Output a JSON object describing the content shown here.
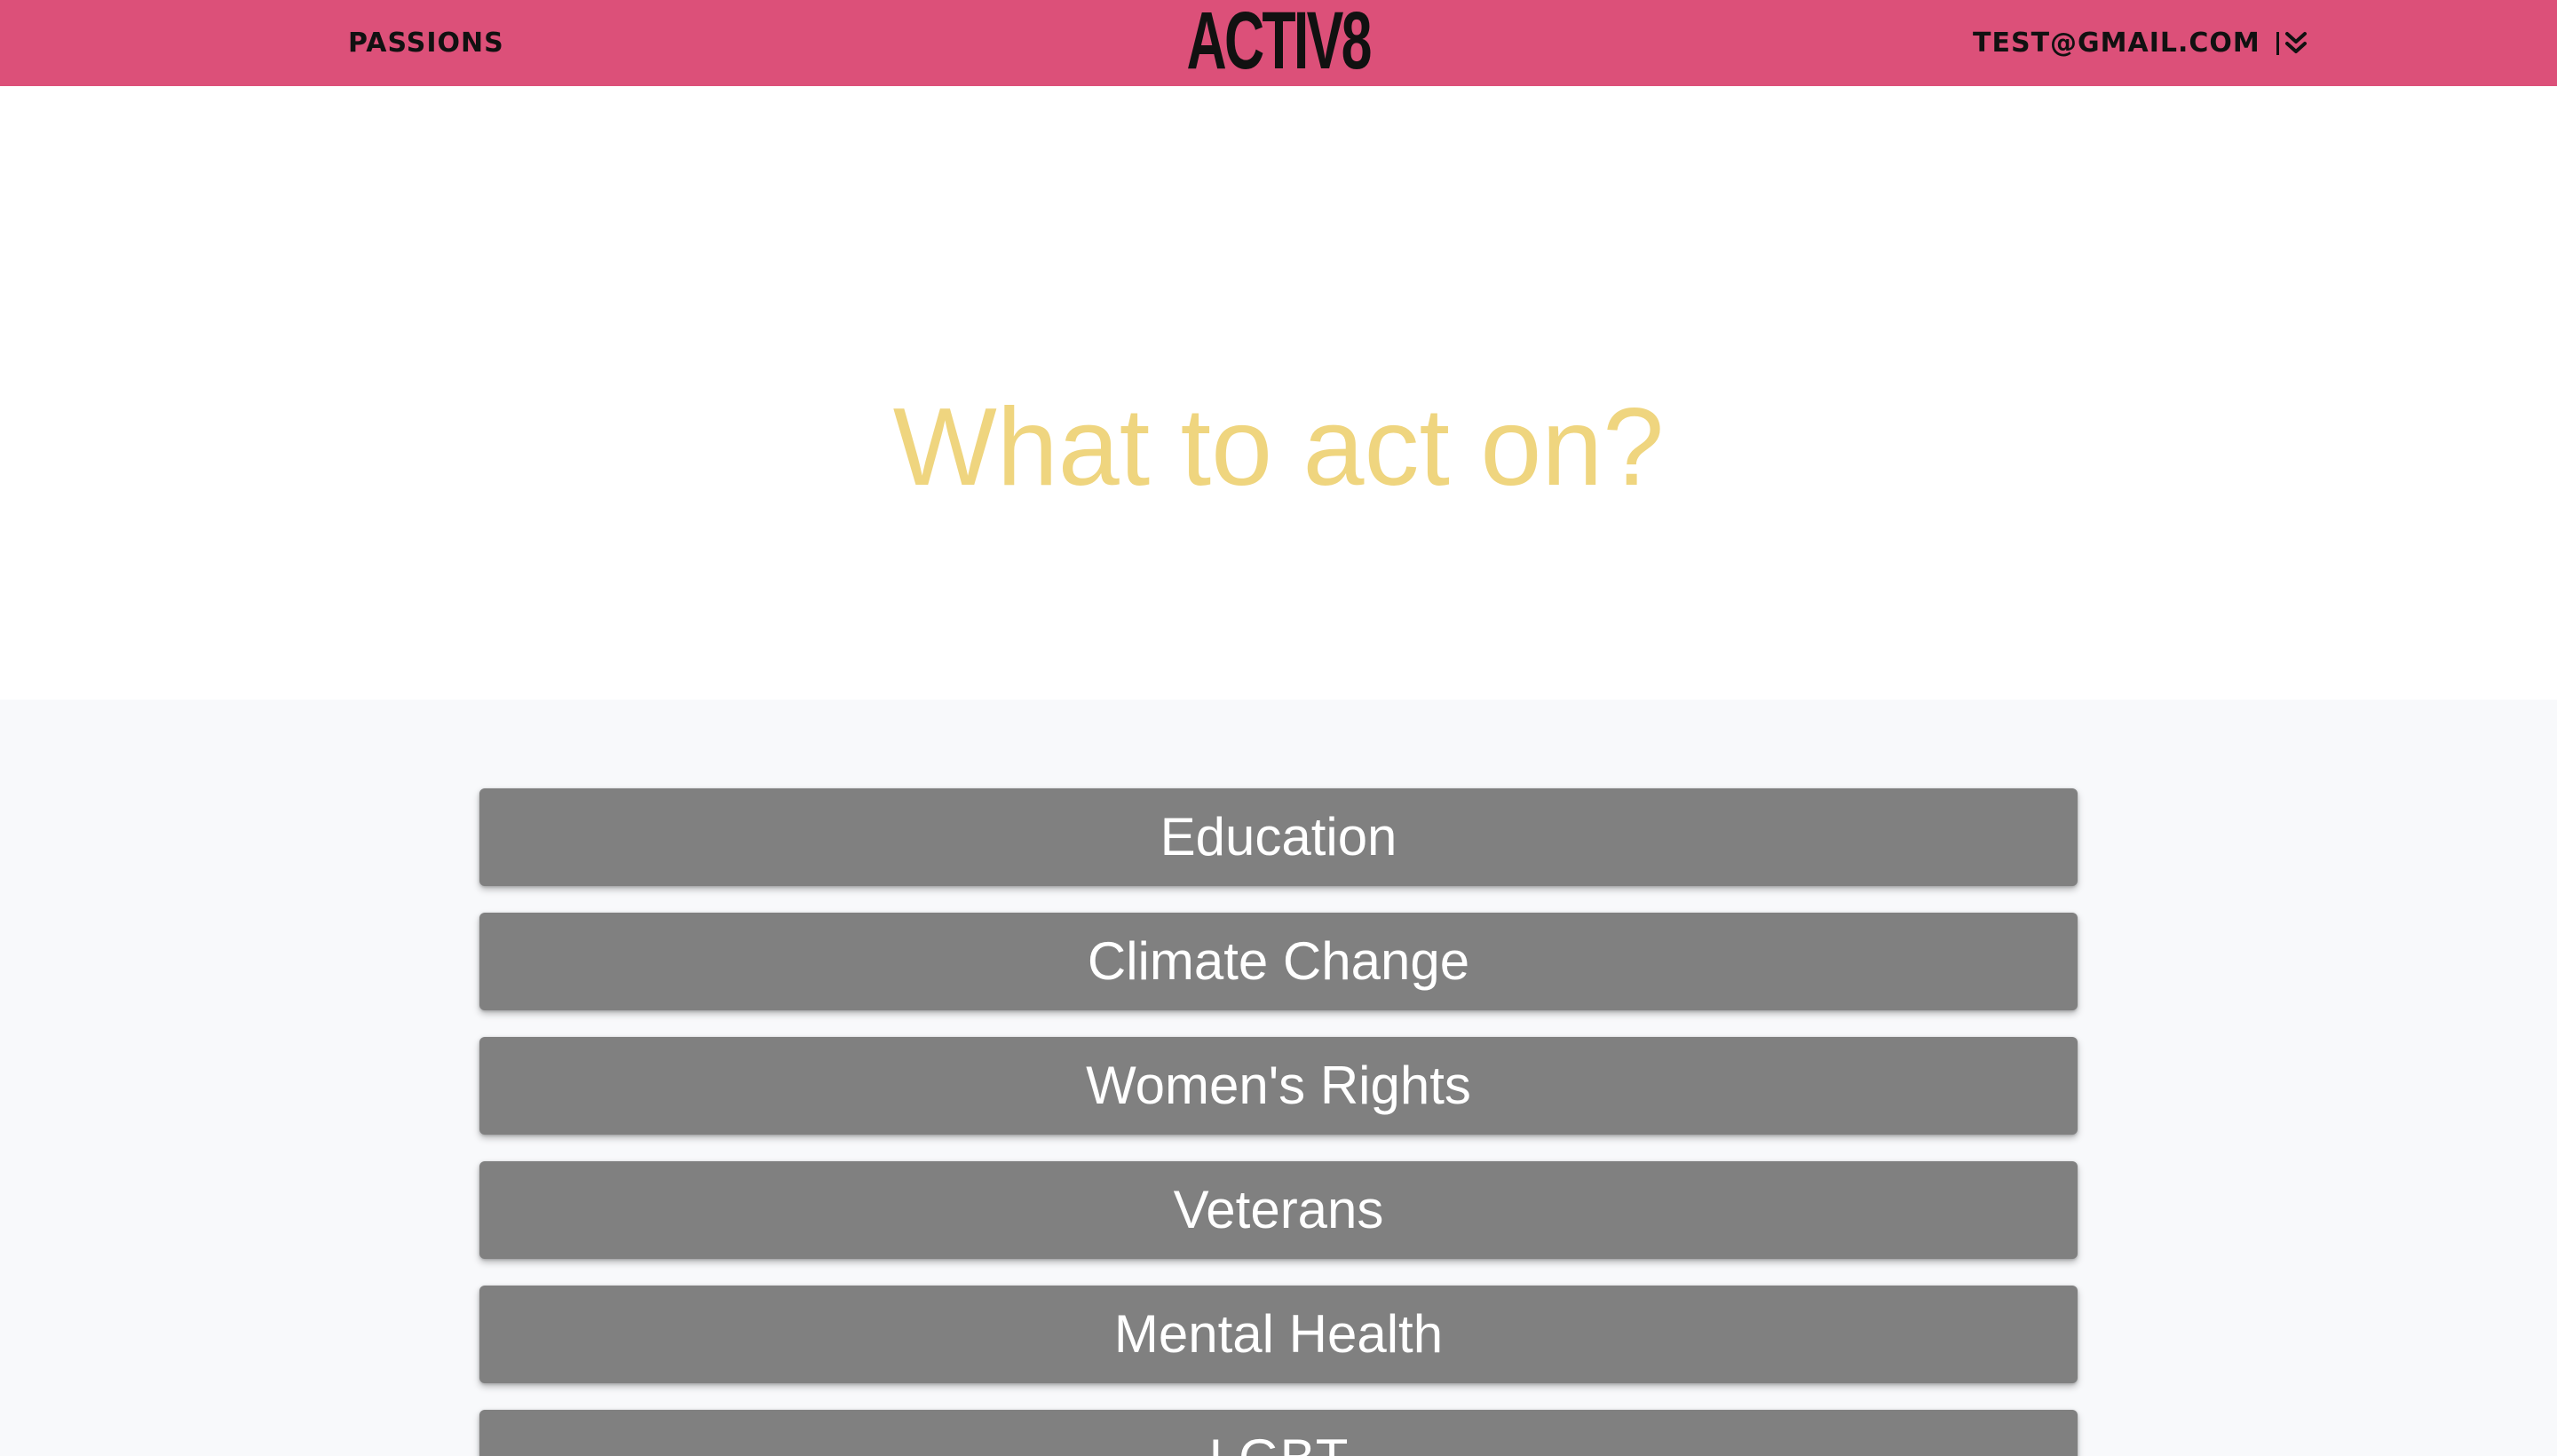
{
  "nav": {
    "left_link": "PASSIONS",
    "logo": "ACTIV8",
    "user_email": "TEST@GMAIL.COM",
    "dropdown_icon": "double-chevron-down-icon",
    "background_color": "#dc5079"
  },
  "hero": {
    "title": "What to act on?",
    "title_color": "#efd57f"
  },
  "passions": [
    "Education",
    "Climate Change",
    "Women's Rights",
    "Veterans",
    "Mental Health",
    "LGBT"
  ],
  "colors": {
    "button_bg": "#808080",
    "list_bg": "#f8f9fb"
  }
}
